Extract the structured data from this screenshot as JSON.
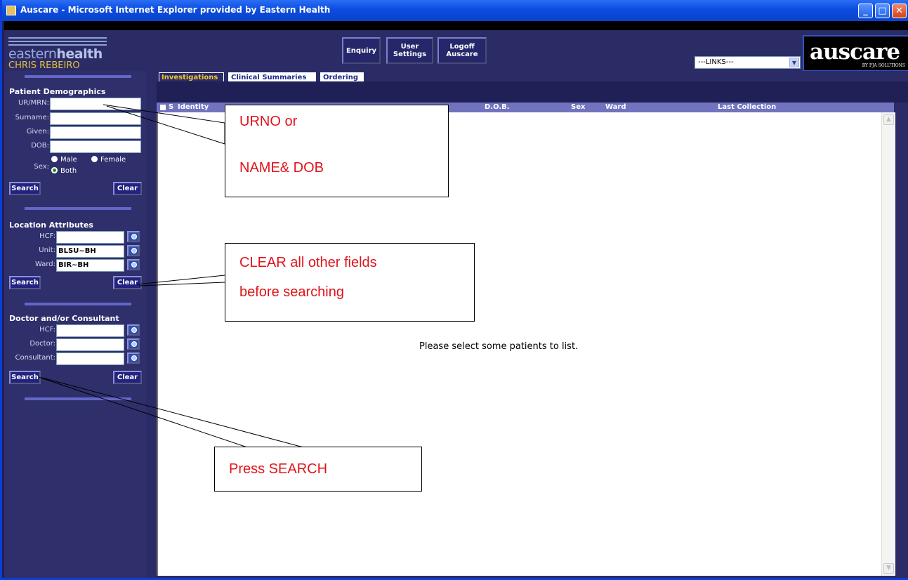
{
  "window": {
    "title": "Auscare - Microsoft Internet Explorer provided by Eastern Health"
  },
  "header": {
    "brand_light": "eastern",
    "brand_bold": "health",
    "username": "CHRIS REBEIRO",
    "buttons": [
      {
        "label_1": "Enquiry",
        "label_2": ""
      },
      {
        "label_1": "User",
        "label_2": "Settings"
      },
      {
        "label_1": "Logoff",
        "label_2": "Auscare"
      }
    ],
    "links_select": "---LINKS---",
    "logo": "auscare",
    "logo_sub": "BY PJA SOLUTIONS"
  },
  "sidebar": {
    "patient": {
      "heading": "Patient Demographics",
      "urmrn_label": "UR/MRN:",
      "surname_label": "Surname:",
      "given_label": "Given:",
      "dob_label": "DOB:",
      "sex_label": "Sex:",
      "male": "Male",
      "female": "Female",
      "both": "Both",
      "search": "Search",
      "clear": "Clear"
    },
    "location": {
      "heading": "Location Attributes",
      "hcf_label": "HCF:",
      "unit_label": "Unit:",
      "unit_value": "BLSU~BH",
      "ward_label": "Ward:",
      "ward_value": "BIR~BH",
      "search": "Search",
      "clear": "Clear"
    },
    "doctor": {
      "heading": "Doctor and/or Consultant",
      "hcf_label": "HCF:",
      "doctor_label": "Doctor:",
      "consultant_label": "Consultant:",
      "search": "Search",
      "clear": "Clear"
    }
  },
  "tabs": [
    "Investigations",
    "Clinical Summaries",
    "Ordering"
  ],
  "columns": {
    "s": "S",
    "identity": "Identity",
    "dob": "D.O.B.",
    "sex": "Sex",
    "ward": "Ward",
    "last_collection": "Last Collection"
  },
  "main": {
    "empty_message": "Please select some patients to list."
  },
  "callouts": {
    "c1_line1": "URNO or",
    "c1_line2": "NAME& DOB",
    "c2_line1": "CLEAR all other fields",
    "c2_line2": "before searching",
    "c3": "Press SEARCH"
  },
  "colors": {
    "sidebar_bg": "#2e2f6b",
    "accent_yellow": "#e5c33c",
    "header_row": "#7173bf",
    "callout_text": "#e0141b"
  }
}
